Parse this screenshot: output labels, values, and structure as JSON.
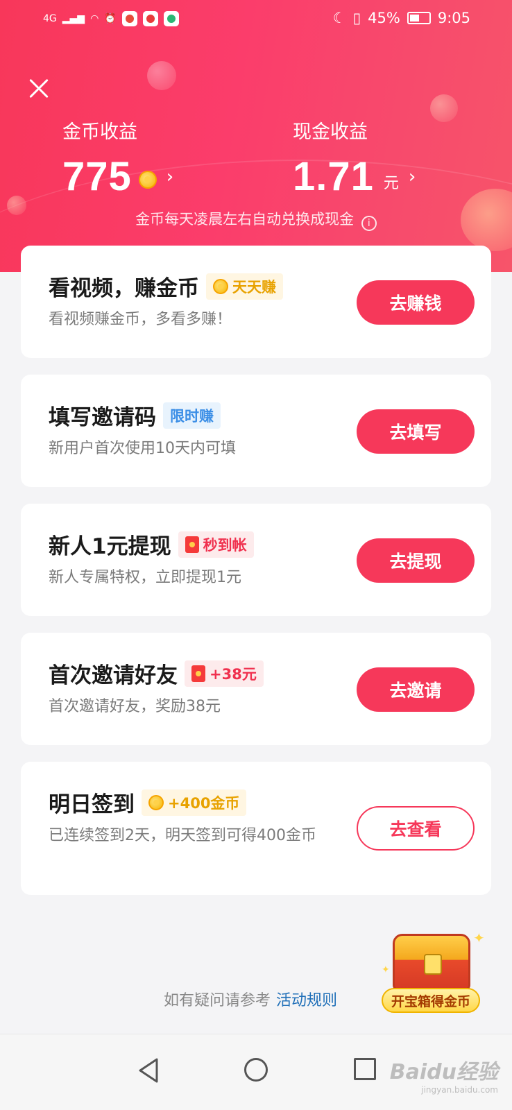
{
  "status_bar": {
    "network": "4G",
    "battery": "45%",
    "time": "9:05"
  },
  "header": {
    "gold_label": "金币收益",
    "gold_value": "775",
    "cash_label": "现金收益",
    "cash_value": "1.71",
    "cash_unit": "元",
    "note": "金币每天凌晨左右自动兑换成现金"
  },
  "tasks": [
    {
      "title": "看视频，赚金币",
      "tag": "天天赚",
      "desc": "看视频赚金币，多看多赚！",
      "button": "去赚钱"
    },
    {
      "title": "填写邀请码",
      "tag": "限时赚",
      "desc": "新用户首次使用10天内可填",
      "button": "去填写"
    },
    {
      "title": "新人1元提现",
      "tag": "秒到帐",
      "desc": "新人专属特权，立即提现1元",
      "button": "去提现"
    },
    {
      "title": "首次邀请好友",
      "tag": "+38元",
      "desc": "首次邀请好友，奖励38元",
      "button": "去邀请"
    },
    {
      "title": "明日签到",
      "tag": "+400金币",
      "desc": "已连续签到2天，明天签到可得400金币",
      "button": "去查看"
    }
  ],
  "footer": {
    "text": "如有疑问请参考",
    "link": "活动规则"
  },
  "treasure": {
    "label": "开宝箱得金币"
  },
  "watermark": {
    "brand": "Baidu经验",
    "url": "jingyan.baidu.com"
  },
  "colors": {
    "primary": "#f6385a",
    "gold": "#e8a200",
    "blue": "#3b8ee6"
  }
}
